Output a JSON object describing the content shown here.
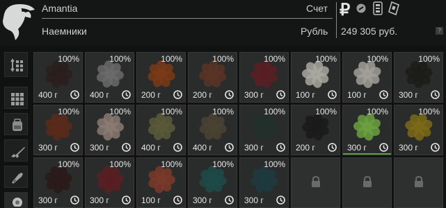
{
  "header": {
    "trader_name": "Amantia",
    "faction": "Наемники",
    "account_label": "Счет",
    "currency_label": "Рубль",
    "balance": "249 305 руб.",
    "ruble_sign": "₽",
    "help": "?"
  },
  "filters": [
    {
      "name": "sort-filter-button",
      "icon": "sort-grid-icon"
    },
    {
      "name": "all-items-filter-button",
      "icon": "grid-icon"
    },
    {
      "name": "gear-filter-button",
      "icon": "backpack-icon"
    },
    {
      "name": "weapons-filter-button",
      "icon": "rifle-icon"
    },
    {
      "name": "mods-filter-button",
      "icon": "weapon-mod-icon"
    },
    {
      "name": "medical-filter-button",
      "icon": "flower-icon"
    }
  ],
  "items": [
    {
      "durability": "100%",
      "price": "400 г",
      "color": "#2a1f1c"
    },
    {
      "durability": "100%",
      "price": "400 г",
      "color": "#6a6a6a"
    },
    {
      "durability": "100%",
      "price": "200 г",
      "color": "#7a3a18"
    },
    {
      "durability": "100%",
      "price": "200 г",
      "color": "#5a3426"
    },
    {
      "durability": "100%",
      "price": "300 г",
      "color": "#5a1e22"
    },
    {
      "durability": "100%",
      "price": "100 г",
      "color": "#a8a8a0"
    },
    {
      "durability": "100%",
      "price": "100 г",
      "color": "#a0a098"
    },
    {
      "durability": "100%",
      "price": "300 г",
      "color": "#1c1c18"
    },
    {
      "durability": "100%",
      "price": "300 г",
      "color": "#5a2a1a"
    },
    {
      "durability": "100%",
      "price": "300 г",
      "color": "#8a7a72"
    },
    {
      "durability": "100%",
      "price": "400 г",
      "color": "#5a5a3a"
    },
    {
      "durability": "100%",
      "price": "400 г",
      "color": "#4a4232"
    },
    {
      "durability": "100%",
      "price": "300 г",
      "color": "#22302a"
    },
    {
      "durability": "100%",
      "price": "200 г",
      "color": "#1a1a1a"
    },
    {
      "durability": "100%",
      "price": "300 г",
      "color": "#6aa040"
    },
    {
      "durability": "100%",
      "price": "300 г",
      "color": "#7a6a18"
    },
    {
      "durability": "100%",
      "price": "300 г",
      "color": "#2a1a18"
    },
    {
      "durability": "100%",
      "price": "300 г",
      "color": "#5a1e22"
    },
    {
      "durability": "100%",
      "price": "100 г",
      "color": "#7a3a2a"
    },
    {
      "durability": "100%",
      "price": "300 г",
      "color": "#1e4a4a"
    },
    {
      "durability": "100%",
      "price": "300 г",
      "color": "#1e3a3e"
    }
  ],
  "locked_slots": 3
}
